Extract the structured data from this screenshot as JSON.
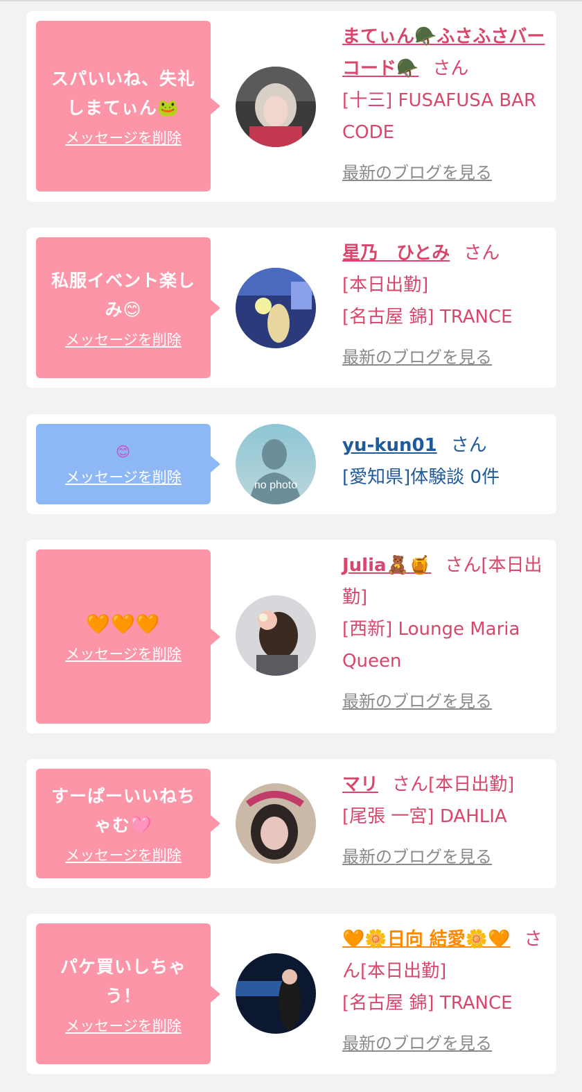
{
  "items": [
    {
      "message": "スパいいね、失礼しまてぃん🐸",
      "delete_label": "メッセージを削除",
      "name": "まてぃん🪖ふさふさバーコード🪖",
      "suffix": "さん",
      "details": [
        "[十三] FUSAFUSA BAR CODE"
      ],
      "blog_label": "最新のブログを見る"
    },
    {
      "message": "私服イベント楽しみ😊",
      "delete_label": "メッセージを削除",
      "name": "星乃　ひとみ",
      "suffix": "さん",
      "details": [
        "[本日出勤]",
        "[名古屋 錦] TRANCE"
      ],
      "blog_label": "最新のブログを見る"
    },
    {
      "message": "😊",
      "delete_label": "メッセージを削除",
      "name": "yu-kun01",
      "suffix": "さん",
      "details": [
        "[愛知県]体験談 0件"
      ],
      "avatar_text": "no photo"
    },
    {
      "message": "🧡🧡🧡",
      "delete_label": "メッセージを削除",
      "name": "Julia🧸🍯",
      "suffix": "さん[本日出勤]",
      "details": [
        "[西新] Lounge Maria Queen"
      ],
      "blog_label": "最新のブログを見る"
    },
    {
      "message": "すーぱーいいねちゃむ🩷",
      "delete_label": "メッセージを削除",
      "name": "マリ",
      "suffix": "さん[本日出勤]",
      "details": [
        "[尾張 一宮] DAHLIA"
      ],
      "blog_label": "最新のブログを見る"
    },
    {
      "message": "パケ買いしちゃう！",
      "delete_label": "メッセージを削除",
      "name": "🧡🌼日向 結愛🌼🧡",
      "suffix": "さん[本日出勤]",
      "details": [
        "[名古屋 錦] TRANCE"
      ],
      "blog_label": "最新のブログを見る"
    }
  ],
  "colors": {
    "bubble_pink": "#fc95a8",
    "bubble_blue": "#8db8f5",
    "name_pink": "#d9466b",
    "name_blue": "#1f5a9a",
    "blog_gray": "#8a8a8a"
  }
}
